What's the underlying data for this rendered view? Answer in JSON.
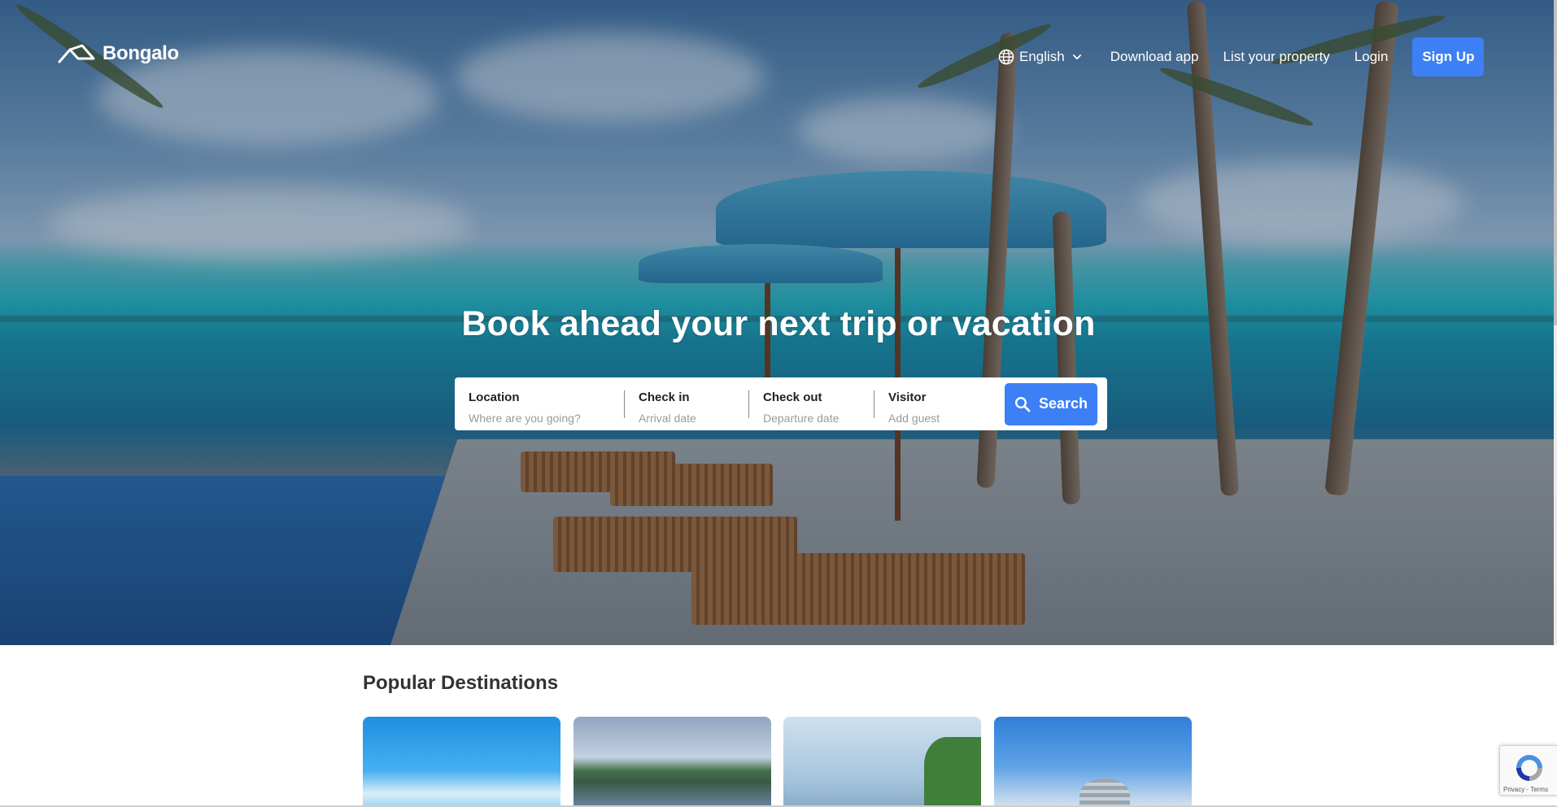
{
  "brand": {
    "name": "Bongalo"
  },
  "nav": {
    "language": "English",
    "links": [
      "Download app",
      "List your property",
      "Login"
    ],
    "signup": "Sign Up"
  },
  "hero": {
    "title": "Book ahead your next trip or vacation"
  },
  "search": {
    "location": {
      "label": "Location",
      "placeholder": "Where are you going?"
    },
    "checkin": {
      "label": "Check in",
      "placeholder": "Arrival date"
    },
    "checkout": {
      "label": "Check out",
      "placeholder": "Departure date"
    },
    "visitor": {
      "label": "Visitor",
      "placeholder": "Add guest"
    },
    "button": "Search"
  },
  "destinations": {
    "title": "Popular Destinations",
    "card_count": 4
  },
  "recaptcha": {
    "links": "Privacy - Terms"
  },
  "colors": {
    "primary": "#3d7ff4",
    "title": "#333333"
  },
  "icons": [
    "logo-icon",
    "globe-icon",
    "chevron-down-icon",
    "search-icon",
    "recaptcha-icon"
  ]
}
